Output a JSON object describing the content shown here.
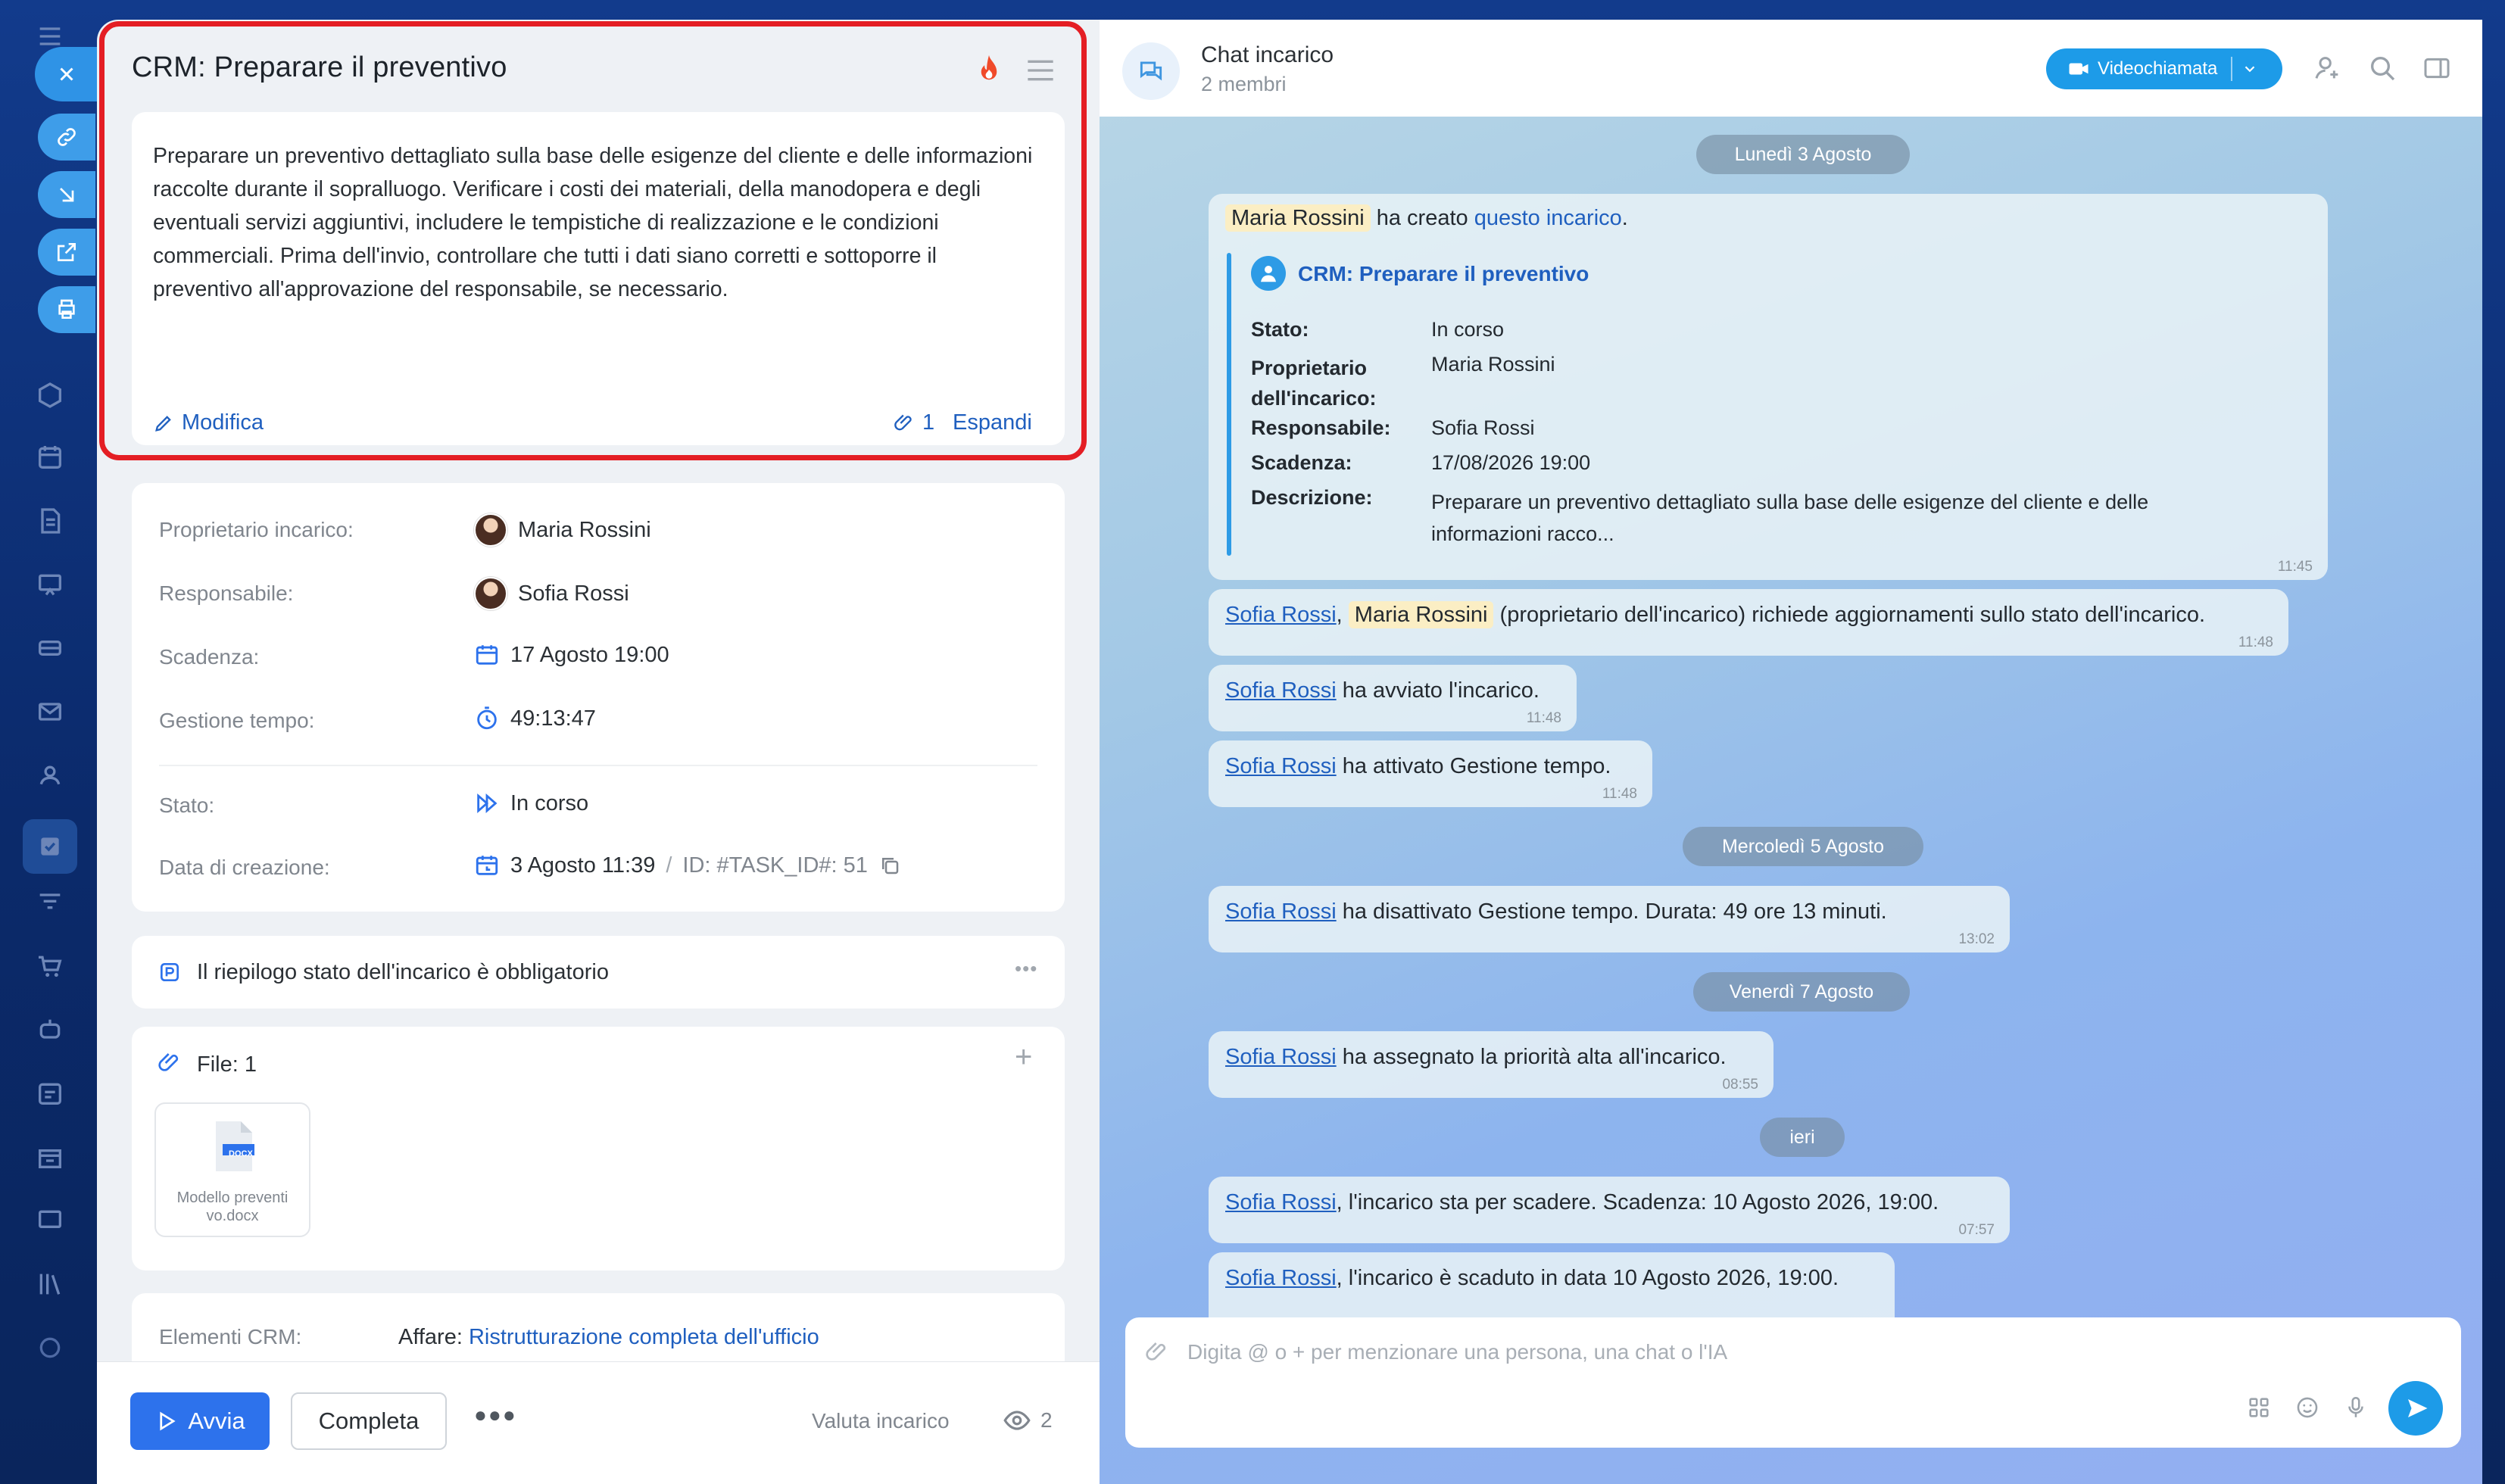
{
  "task": {
    "title": "CRM: Preparare il preventivo",
    "description": "Preparare un preventivo dettagliato sulla base delle esigenze del cliente e delle informazioni raccolte durante il sopralluogo. Verificare i costi dei materiali, della manodopera e degli eventuali servizi aggiuntivi, includere le tempistiche di realizzazione e le condizioni commerciali. Prima dell'invio, controllare che tutti i dati siano corretti e sottoporre il preventivo all'approvazione del responsabile, se necessario.",
    "edit_label": "Modifica",
    "attachment_count": "1",
    "expand_label": "Espandi",
    "fields": {
      "owner_label": "Proprietario incarico:",
      "owner_value": "Maria Rossini",
      "assignee_label": "Responsabile:",
      "assignee_value": "Sofia Rossi",
      "deadline_label": "Scadenza:",
      "deadline_value": "17 Agosto 19:00",
      "time_label": "Gestione tempo:",
      "time_value": "49:13:47",
      "status_label": "Stato:",
      "status_value": "In corso",
      "created_label": "Data di creazione:",
      "created_value": "3 Agosto 11:39",
      "id_value": "ID: #TASK_ID#: 51"
    },
    "summary_required": "Il riepilogo stato dell'incarico è obbligatorio",
    "files_label": "File: 1",
    "file_ext": "DOCX",
    "file_name_1": "Modello preventi",
    "file_name_2": "vo.docx",
    "crm_label": "Elementi CRM:",
    "crm_deal_prefix": "Affare:",
    "crm_deal_name": "Ristrutturazione completa dell'ufficio",
    "actions": {
      "start": "Avvia",
      "complete": "Completa",
      "rate": "Valuta incarico",
      "views": "2"
    }
  },
  "chat": {
    "title": "Chat incarico",
    "members": "2 membri",
    "video_call": "Videochiamata",
    "date_1": "Lunedì 3 Agosto",
    "date_2": "Mercoledì 5 Agosto",
    "date_3": "Venerdì 7 Agosto",
    "date_4": "ieri",
    "msg1": {
      "author": "Maria Rossini",
      "text": "ha creato",
      "link": "questo incarico",
      "card_title": "CRM: Preparare il preventivo",
      "stato_label": "Stato:",
      "stato_value": "In corso",
      "owner_label_1": "Proprietario",
      "owner_label_2": "dell'incarico:",
      "owner_value": "Maria Rossini",
      "resp_label": "Responsabile:",
      "resp_value": "Sofia Rossi",
      "scad_label": "Scadenza:",
      "scad_value": "17/08/2026 19:00",
      "desc_label": "Descrizione:",
      "desc_value_1": "Preparare un preventivo dettagliato sulla base delle esigenze del cliente e delle",
      "desc_value_2": "informazioni racco...",
      "time": "11:45"
    },
    "msg2": {
      "name1": "Sofia Rossi",
      "name2": "Maria Rossini",
      "text": "(proprietario dell'incarico) richiede aggiornamenti sullo stato dell'incarico.",
      "time": "11:48"
    },
    "msg3": {
      "name": "Sofia Rossi",
      "text": "ha avviato l'incarico.",
      "time": "11:48"
    },
    "msg4": {
      "name": "Sofia Rossi",
      "text": "ha attivato Gestione tempo.",
      "time": "11:48"
    },
    "msg5": {
      "name": "Sofia Rossi",
      "text": "ha disattivato Gestione tempo. Durata: 49 ore 13 minuti.",
      "time": "13:02"
    },
    "msg6": {
      "name": "Sofia Rossi",
      "text": "ha assegnato la priorità alta all'incarico.",
      "time": "08:55"
    },
    "msg7": {
      "name": "Sofia Rossi",
      "text": ", l'incarico sta per scadere. Scadenza: 10 Agosto 2026, 19:00.",
      "time": "07:57"
    },
    "msg8": {
      "name": "Sofia Rossi",
      "text": ", l'incarico è scaduto in data 10 Agosto 2026, 19:00."
    },
    "input_placeholder": "Digita @ o + per menzionare una persona, una chat o l'IA"
  },
  "colors": {
    "accent": "#2d72ec",
    "highlight_border": "#e41e24",
    "link": "#1f5fbf",
    "send": "#1d9be8"
  }
}
